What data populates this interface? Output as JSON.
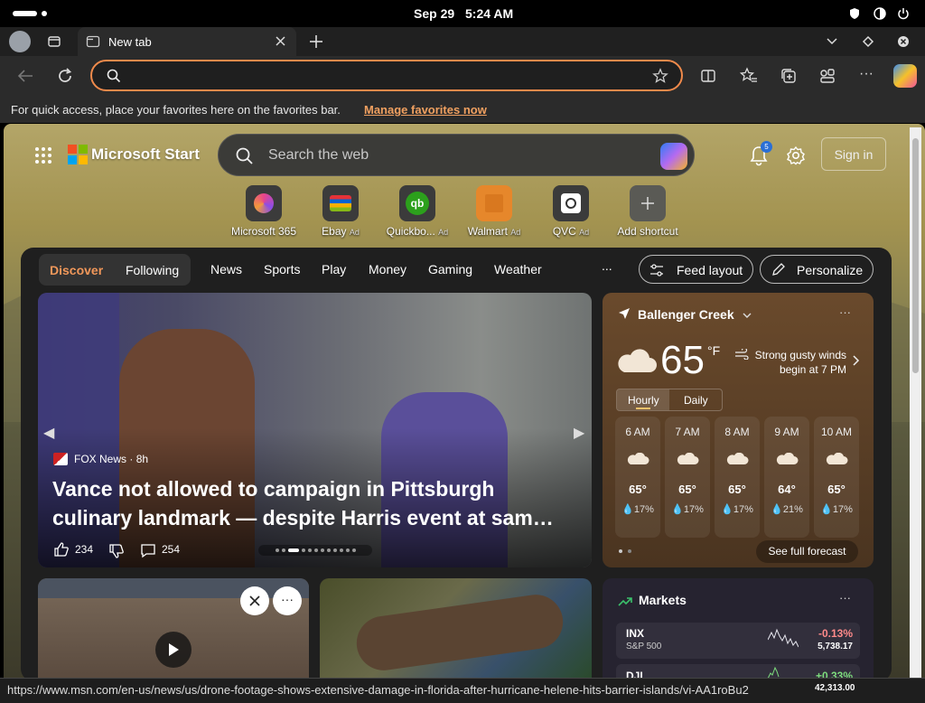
{
  "system": {
    "date": "Sep 29",
    "time": "5:24 AM"
  },
  "tab": {
    "title": "New tab"
  },
  "favorites_bar": {
    "message": "For quick access, place your favorites here on the favorites bar.",
    "link": "Manage favorites now"
  },
  "header": {
    "brand": "Microsoft Start",
    "search_placeholder": "Search the web",
    "notification_count": "5",
    "sign_in": "Sign in"
  },
  "shortcuts": [
    {
      "label": "Microsoft 365",
      "ad": ""
    },
    {
      "label": "Ebay",
      "ad": "Ad"
    },
    {
      "label": "Quickbo...",
      "ad": "Ad"
    },
    {
      "label": "Walmart",
      "ad": "Ad"
    },
    {
      "label": "QVC",
      "ad": "Ad"
    },
    {
      "label": "Add shortcut",
      "ad": ""
    }
  ],
  "nav": {
    "discover": "Discover",
    "following": "Following",
    "items": [
      "News",
      "Sports",
      "Play",
      "Money",
      "Gaming",
      "Weather"
    ],
    "more": "...",
    "feed_layout": "Feed layout",
    "personalize": "Personalize"
  },
  "hero": {
    "source": "FOX News",
    "age": "8h",
    "headline_line1": "Vance not allowed to campaign in Pittsburgh",
    "headline_line2": "culinary landmark — despite Harris event at sam…",
    "likes": "234",
    "comments": "254"
  },
  "weather": {
    "location": "Ballenger Creek",
    "temp": "65",
    "unit": "°F",
    "alert_line1": "Strong gusty winds",
    "alert_line2": "begin at 7 PM",
    "tabs": [
      "Hourly",
      "Daily"
    ],
    "hours": [
      {
        "time": "6 AM",
        "temp": "65°",
        "precip": "17%"
      },
      {
        "time": "7 AM",
        "temp": "65°",
        "precip": "17%"
      },
      {
        "time": "8 AM",
        "temp": "65°",
        "precip": "17%"
      },
      {
        "time": "9 AM",
        "temp": "64°",
        "precip": "21%"
      },
      {
        "time": "10 AM",
        "temp": "65°",
        "precip": "17%"
      }
    ],
    "forecast_button": "See full forecast"
  },
  "markets": {
    "title": "Markets",
    "rows": [
      {
        "symbol": "INX",
        "name": "S&P 500",
        "change": "-0.13%",
        "price": "5,738.17",
        "color": "#ff8a8a"
      },
      {
        "symbol": "DJI",
        "name": "",
        "change": "+0.33%",
        "price": "42,313.00",
        "color": "#7ddc7d"
      }
    ]
  },
  "status_url": "https://www.msn.com/en-us/news/us/drone-footage-shows-extensive-damage-in-florida-after-hurricane-helene-hits-barrier-islands/vi-AA1roBu2"
}
